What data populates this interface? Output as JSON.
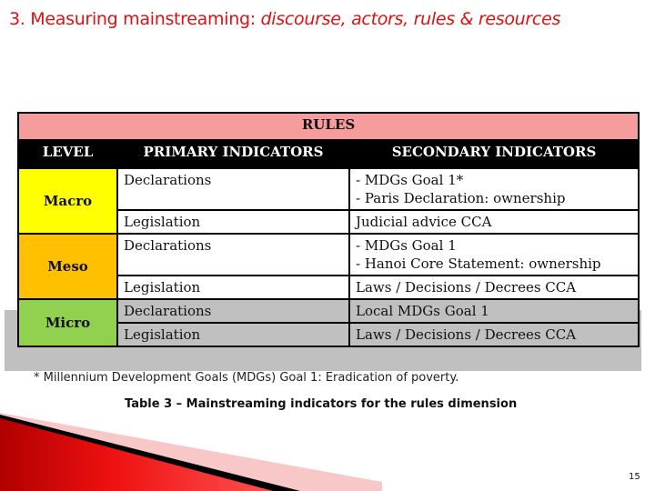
{
  "slide": {
    "title_prefix": "3. Measuring mainstreaming: ",
    "title_emphasis": "discourse, actors, rules & resources",
    "page_number": "15"
  },
  "table": {
    "dimension_header": "RULES",
    "columns": [
      "LEVEL",
      "PRIMARY INDICATORS",
      "SECONDARY INDICATORS"
    ],
    "groups": [
      {
        "level": "Macro",
        "color": "#ffff00",
        "rows": [
          {
            "primary": "Declarations",
            "secondary": [
              "- MDGs Goal 1*",
              "- Paris Declaration: ownership"
            ]
          },
          {
            "primary": "Legislation",
            "secondary": [
              "Judicial advice CCA"
            ]
          }
        ]
      },
      {
        "level": "Meso",
        "color": "#ffc000",
        "rows": [
          {
            "primary": "Declarations",
            "secondary": [
              "- MDGs Goal 1",
              "- Hanoi Core Statement: ownership"
            ]
          },
          {
            "primary": "Legislation",
            "secondary": [
              "Laws / Decisions / Decrees CCA"
            ]
          }
        ]
      },
      {
        "level": "Micro",
        "color": "#92d050",
        "rows": [
          {
            "primary": "Declarations",
            "secondary": [
              "Local MDGs Goal 1"
            ]
          },
          {
            "primary": "Legislation",
            "secondary": [
              "Laws / Decisions / Decrees CCA"
            ]
          }
        ]
      }
    ]
  },
  "footnote": "* Millennium Development Goals (MDGs) Goal 1: Eradication of poverty.",
  "caption": "Table 3 – Mainstreaming indicators for the rules dimension",
  "colors": {
    "title": "#e01010",
    "rules_band": "#f79c9c",
    "header_band": "#000000",
    "micro_row_bg": "#c0c0c0",
    "swoosh_red": "#e00000"
  }
}
